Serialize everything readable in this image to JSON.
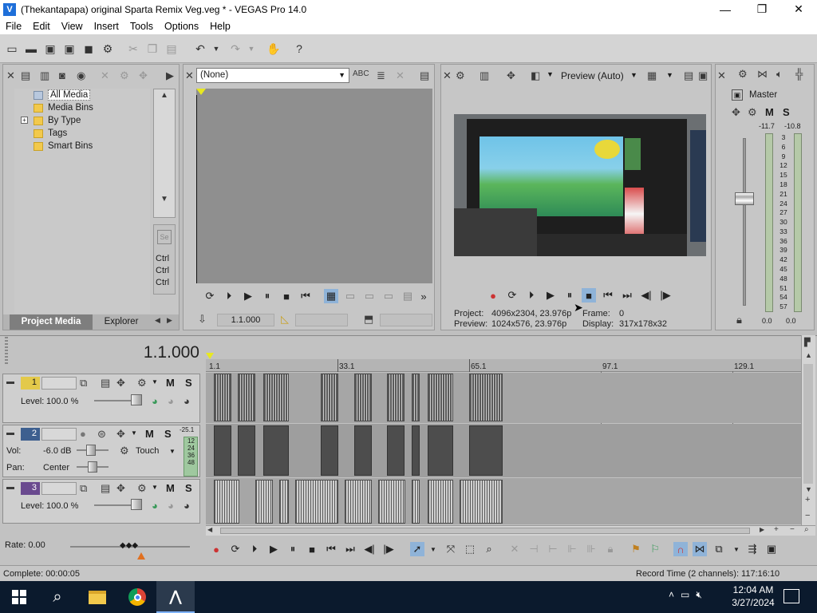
{
  "window": {
    "title": "(Thekantapapa) original Sparta Remix Veg.veg * - VEGAS Pro 14.0",
    "app_icon_glyph": "V",
    "controls": {
      "minimize": "—",
      "maximize": "❐",
      "close": "✕"
    }
  },
  "menu": [
    "File",
    "Edit",
    "View",
    "Insert",
    "Tools",
    "Options",
    "Help"
  ],
  "project_media": {
    "tree": [
      "All Media",
      "Media Bins",
      "By Type",
      "Tags",
      "Smart Bins"
    ],
    "expand_glyph": "+",
    "ctrl_labels": [
      "Ctrl",
      "Ctrl",
      "Ctrl"
    ],
    "tabs": {
      "active": "Project Media",
      "other": "Explorer"
    }
  },
  "trimmer": {
    "select_value": "(None)",
    "timecode": "1.1.000"
  },
  "preview": {
    "mode": "Preview (Auto)",
    "project_label": "Project:",
    "project_value": "4096x2304, 23.976p",
    "preview_label": "Preview:",
    "preview_value": "1024x576, 23.976p",
    "frame_label": "Frame:",
    "frame_value": "0",
    "display_label": "Display:",
    "display_value": "317x178x32"
  },
  "master": {
    "label": "Master",
    "m": "M",
    "s": "S",
    "peak_left": "-11.7",
    "peak_right": "-10.8",
    "scale": [
      "3",
      "6",
      "9",
      "12",
      "15",
      "18",
      "21",
      "24",
      "27",
      "30",
      "33",
      "36",
      "39",
      "42",
      "45",
      "48",
      "51",
      "54",
      "57"
    ],
    "bottom_left": "0.0",
    "bottom_right": "0.0"
  },
  "timeline": {
    "timecode": "1.1.000",
    "ruler": [
      "1.1",
      "33.1",
      "65.1",
      "97.1",
      "129.1"
    ],
    "tracks": [
      {
        "num": "1",
        "level_label": "Level:",
        "level_value": "100.0 %",
        "m": "M",
        "s": "S"
      },
      {
        "num": "2",
        "vol_label": "Vol:",
        "vol_value": "-6.0 dB",
        "pan_label": "Pan:",
        "pan_value": "Center",
        "mode": "Touch",
        "m": "M",
        "s": "S",
        "meter_top": "-25.1",
        "meter_scale": [
          "12",
          "24",
          "36",
          "48"
        ]
      },
      {
        "num": "3",
        "level_label": "Level:",
        "level_value": "100.0 %",
        "m": "M",
        "s": "S"
      }
    ]
  },
  "rate": "Rate: 0.00",
  "status": {
    "complete": "Complete: 00:00:05",
    "record_time": "Record Time (2 channels): 117:16:10"
  },
  "taskbar": {
    "time": "12:04 AM",
    "date": "3/27/2024"
  },
  "colors": {
    "track1": "#e3c94a",
    "track2": "#3d5f8f",
    "track3": "#6a4a8f",
    "meter_green": "#7fae6a"
  }
}
